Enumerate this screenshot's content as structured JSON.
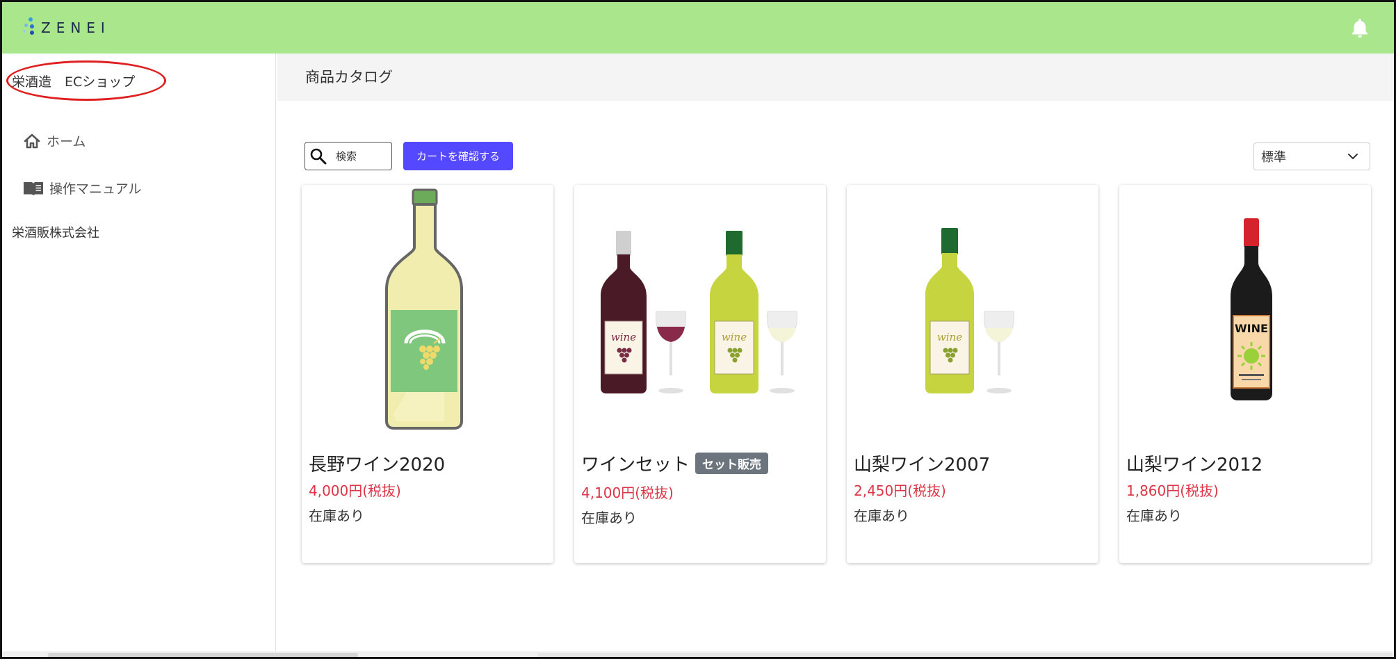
{
  "header": {
    "logo_text": "ZENEI",
    "bell_icon": "bell-icon",
    "accent_color": "#a9e68c"
  },
  "sidebar": {
    "shop_name": "栄酒造　ECショップ",
    "items": [
      {
        "label": "ホーム",
        "icon": "home-icon"
      },
      {
        "label": "操作マニュアル",
        "icon": "book-icon"
      }
    ],
    "company": "栄酒販株式会社"
  },
  "main": {
    "title": "商品カタログ",
    "search": {
      "placeholder": "検索",
      "icon": "search-icon"
    },
    "cart_button": "カートを確認する",
    "sort": {
      "selected": "標準",
      "icon": "chevron-down-icon"
    },
    "products": [
      {
        "name": "長野ワイン2020",
        "price": "4,000円(税抜)",
        "stock": "在庫あり",
        "badge": ""
      },
      {
        "name": "ワインセット",
        "price": "4,100円(税抜)",
        "stock": "在庫あり",
        "badge": "セット販売"
      },
      {
        "name": "山梨ワイン2007",
        "price": "2,450円(税抜)",
        "stock": "在庫あり",
        "badge": ""
      },
      {
        "name": "山梨ワイン2012",
        "price": "1,860円(税抜)",
        "stock": "在庫あり",
        "badge": ""
      }
    ],
    "price_color": "#dc3545",
    "button_color": "#5549ff"
  }
}
